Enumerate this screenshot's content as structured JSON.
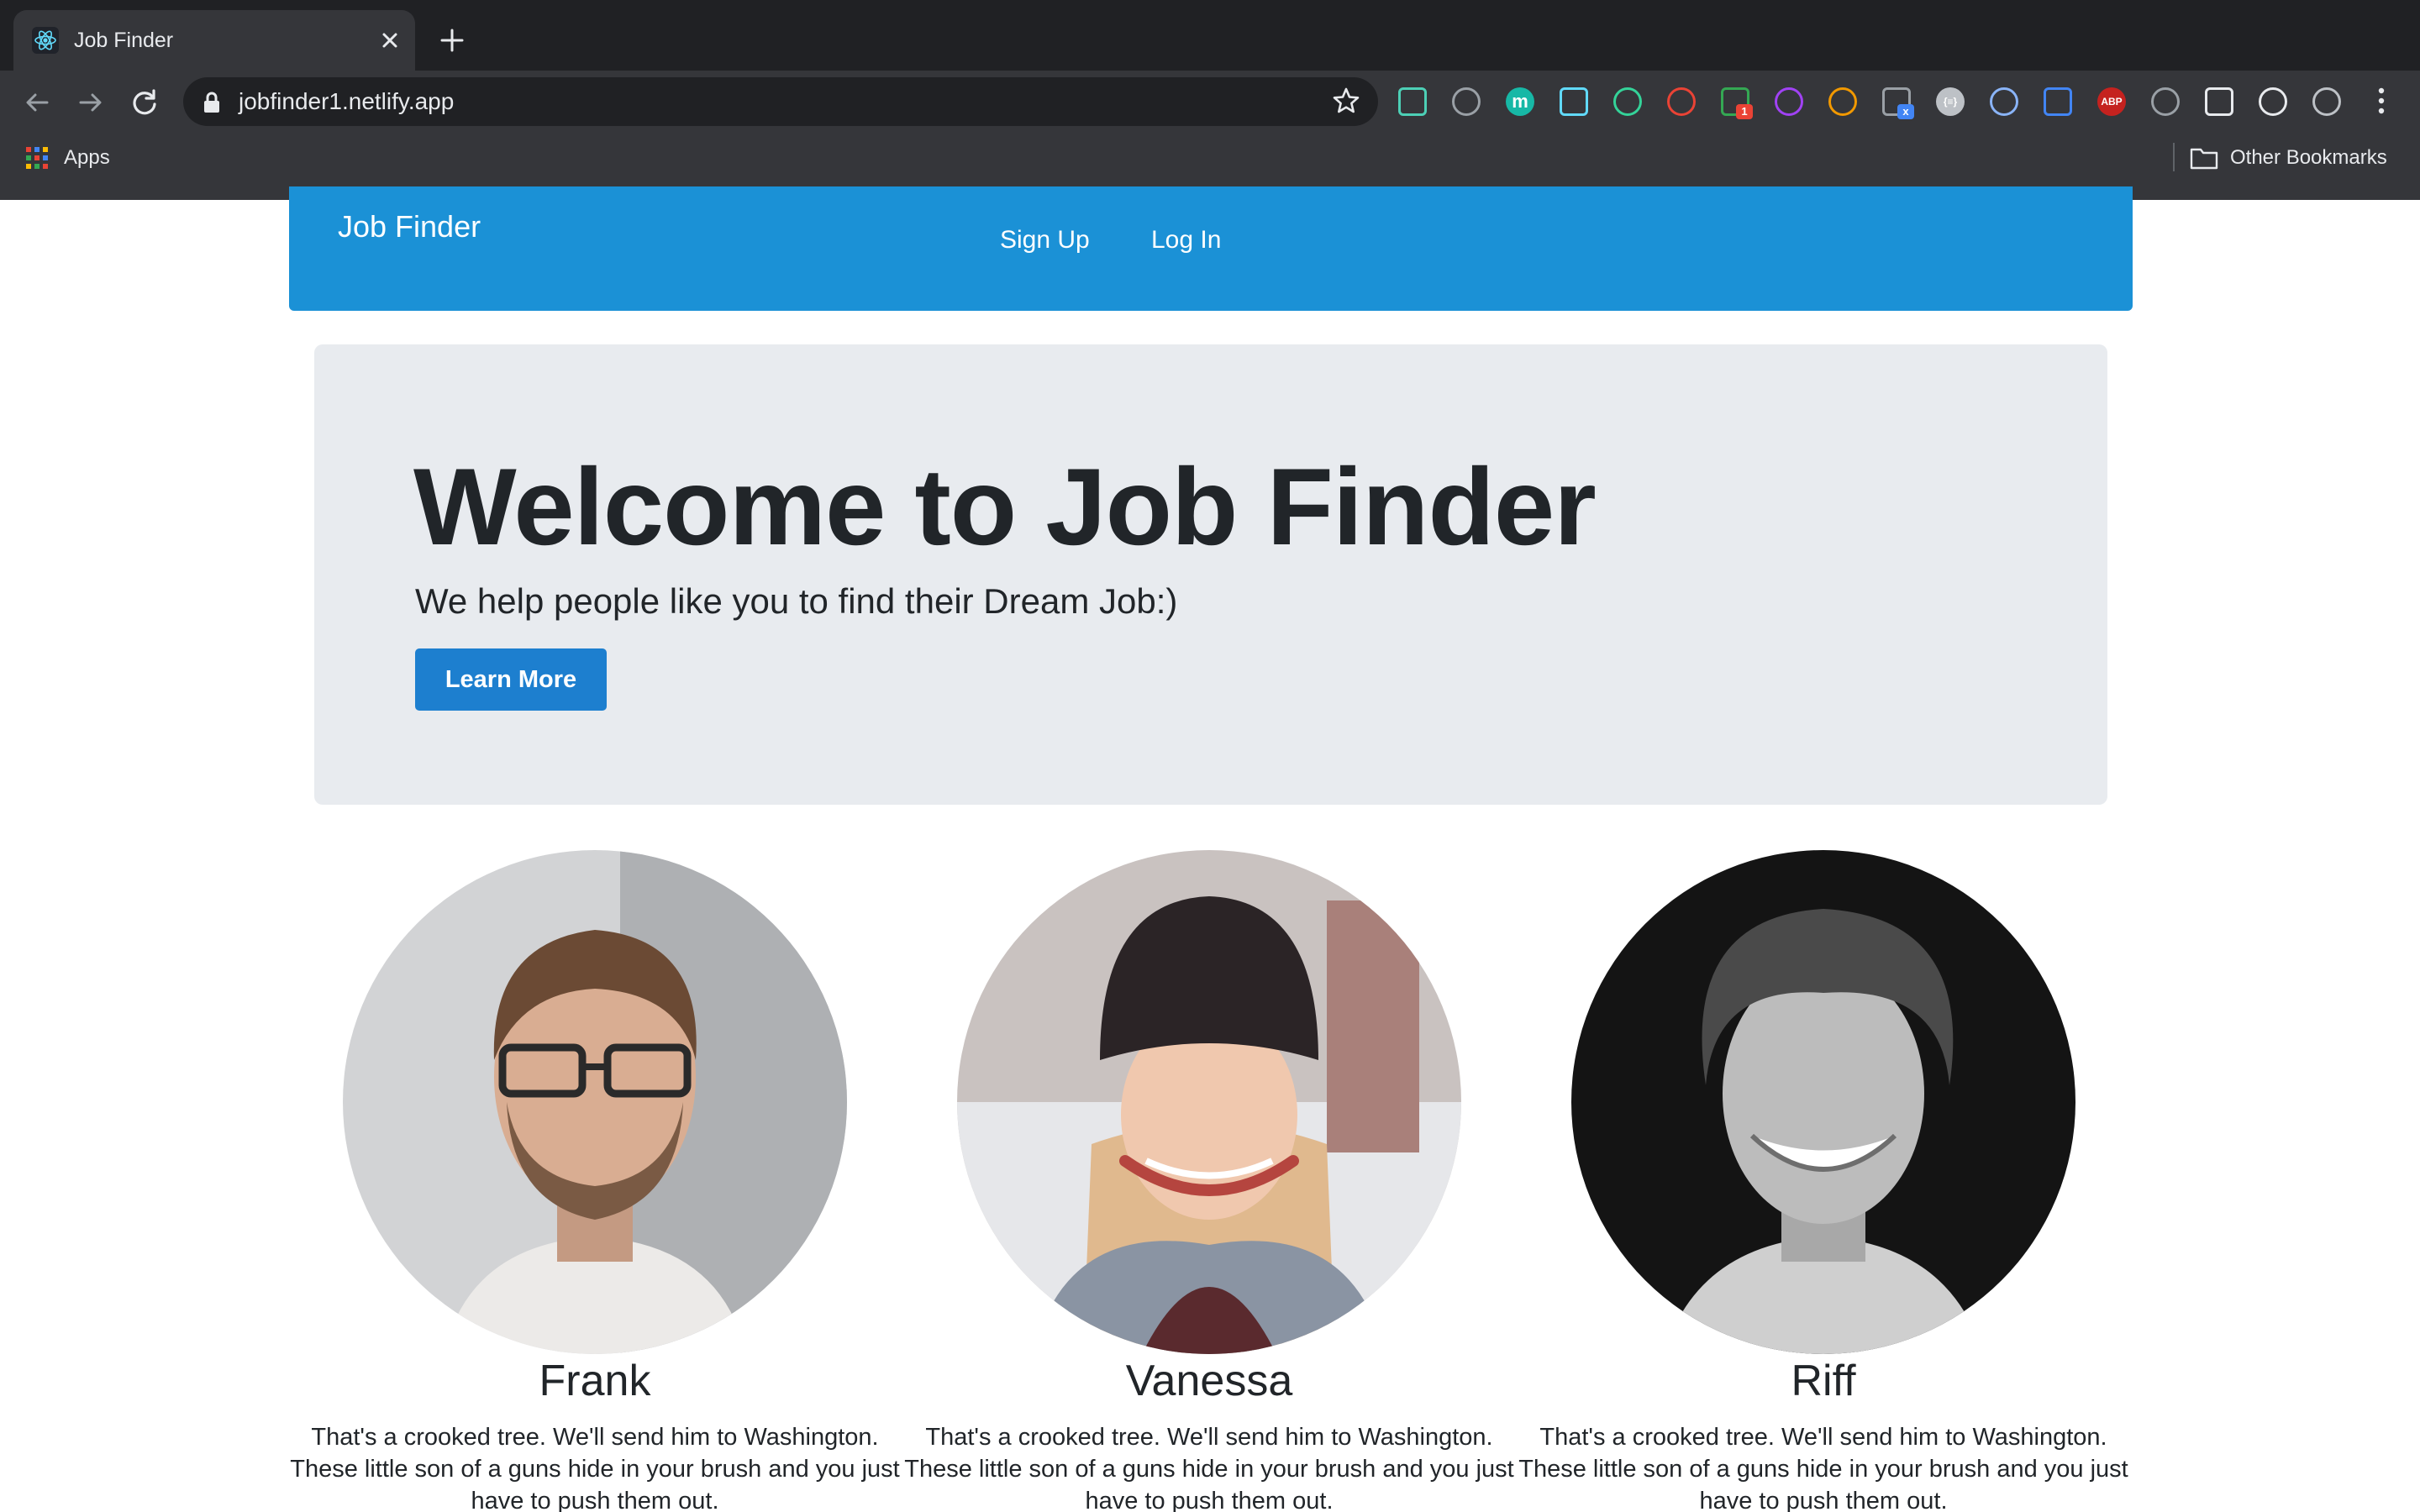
{
  "browser": {
    "tab_title": "Job Finder",
    "url": "jobfinder1.netlify.app",
    "bookmarks": {
      "apps_label": "Apps",
      "other_label": "Other Bookmarks"
    },
    "extension_icons": [
      {
        "name": "ext-notes-icon",
        "color": "#4dd0b6"
      },
      {
        "name": "ext-whale-icon",
        "color": "#9aa0a6"
      },
      {
        "name": "ext-m-icon",
        "color": "#17b8a6",
        "glyph": "m"
      },
      {
        "name": "ext-react-icon",
        "color": "#61dafb"
      },
      {
        "name": "ext-target-icon",
        "color": "#34d399"
      },
      {
        "name": "ext-org-icon",
        "color": "#ea4335"
      },
      {
        "name": "ext-bolt-icon",
        "color": "#34a853",
        "badge": "1"
      },
      {
        "name": "ext-wave-icon",
        "color": "#a142f4"
      },
      {
        "name": "ext-gear-icon",
        "color": "#f29900"
      },
      {
        "name": "ext-circle-icon",
        "color": "#9aa0a6",
        "badge": "x"
      },
      {
        "name": "ext-braces-icon",
        "color": "#bdc1c6",
        "glyph": "{≡}"
      },
      {
        "name": "ext-pen-icon",
        "color": "#8ab4f8"
      },
      {
        "name": "ext-download-icon",
        "color": "#4285f4"
      },
      {
        "name": "ext-abp-icon",
        "color": "#c5221f",
        "glyph": "ABP"
      },
      {
        "name": "ext-bug-icon",
        "color": "#9aa0a6"
      },
      {
        "name": "extensions-puzzle-icon",
        "color": "#e8eaed"
      },
      {
        "name": "media-queue-icon",
        "color": "#e8eaed"
      },
      {
        "name": "ext-page-icon",
        "color": "#bdc1c6"
      }
    ]
  },
  "navbar": {
    "brand": "Job Finder",
    "links": [
      "Sign Up",
      "Log In"
    ]
  },
  "hero": {
    "title": "Welcome to Job Finder",
    "subtitle": "We help people like you to find their Dream Job:)",
    "button_label": "Learn More"
  },
  "people": [
    {
      "name": "Frank",
      "description": "That's a crooked tree. We'll send him to Washington. These little son of a guns hide in your brush and you just have to push them out."
    },
    {
      "name": "Vanessa",
      "description": "That's a crooked tree. We'll send him to Washington. These little son of a guns hide in your brush and you just have to push them out."
    },
    {
      "name": "Riff",
      "description": "That's a crooked tree. We'll send him to Washington. These little son of a guns hide in your brush and you just have to push them out."
    }
  ],
  "colors": {
    "navbar": "#1b91d6",
    "button": "#1d7fcf",
    "hero_bg": "#e8ebef",
    "chrome_dark": "#202124",
    "chrome_toolbar": "#35363a"
  }
}
